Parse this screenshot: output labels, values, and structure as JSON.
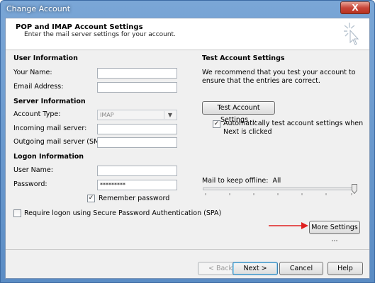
{
  "window": {
    "title": "Change Account",
    "close_label": "X"
  },
  "header": {
    "title": "POP and IMAP Account Settings",
    "subtitle": "Enter the mail server settings for your account."
  },
  "user_info": {
    "heading": "User Information",
    "your_name_label": "Your Name:",
    "your_name_value": "",
    "email_label": "Email Address:",
    "email_value": ""
  },
  "server_info": {
    "heading": "Server Information",
    "account_type_label": "Account Type:",
    "account_type_value": "IMAP",
    "incoming_label": "Incoming mail server:",
    "incoming_value": "",
    "outgoing_label": "Outgoing mail server (SMTP):",
    "outgoing_value": ""
  },
  "logon_info": {
    "heading": "Logon Information",
    "user_name_label": "User Name:",
    "user_name_value": "",
    "password_label": "Password:",
    "password_value": "*********",
    "remember_label": "Remember password",
    "remember_checked": true,
    "spa_label": "Require logon using Secure Password Authentication (SPA)",
    "spa_checked": false
  },
  "test_settings": {
    "heading": "Test Account Settings",
    "description": "We recommend that you test your account to ensure that the entries are correct.",
    "test_button": "Test Account Settings ...",
    "auto_test_label": "Automatically test account settings when Next is clicked",
    "auto_test_checked": true
  },
  "offline": {
    "label": "Mail to keep offline:",
    "value": "All",
    "slider_position": 1.0
  },
  "more_settings_button": "More Settings ...",
  "footer": {
    "back": "< Back",
    "next": "Next >",
    "cancel": "Cancel",
    "help": "Help"
  },
  "colors": {
    "annotation_arrow": "#e02020",
    "title_bar": "#6a9bd0"
  }
}
